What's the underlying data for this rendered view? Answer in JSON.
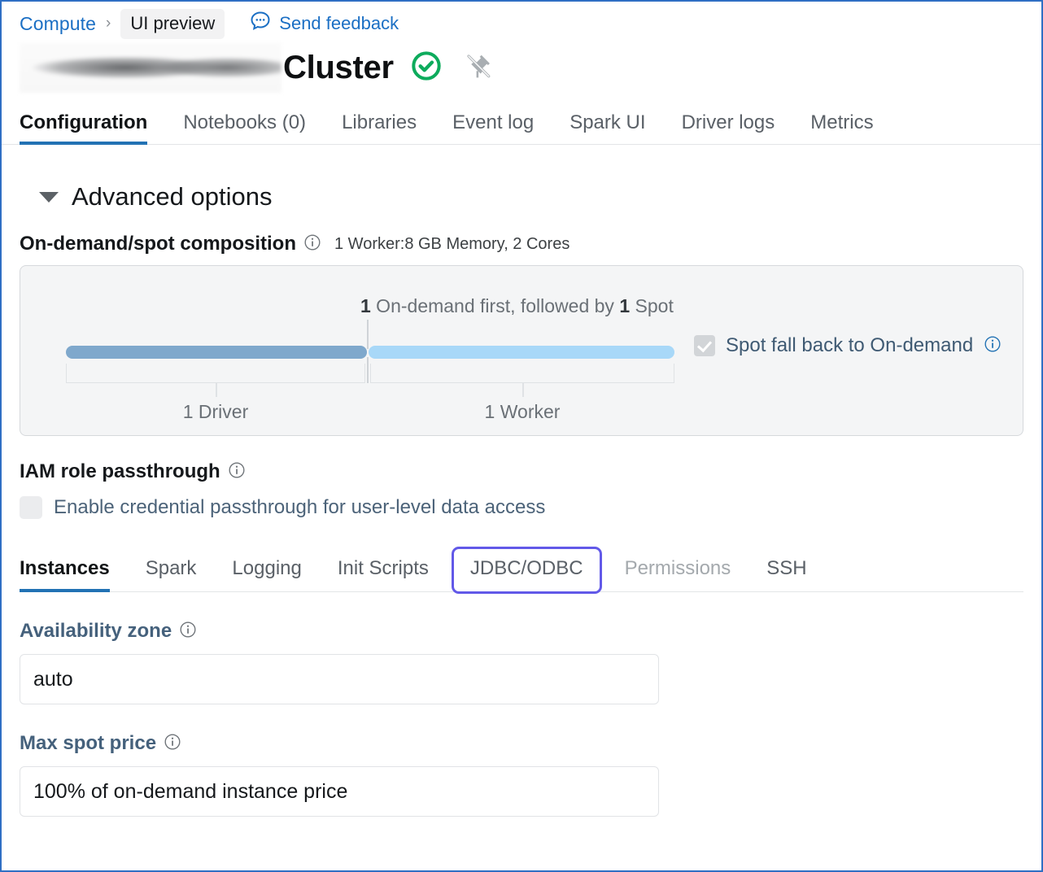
{
  "breadcrumb": {
    "parent": "Compute",
    "separator": "›",
    "preview_badge": "UI preview",
    "feedback_label": "Send feedback"
  },
  "header": {
    "cluster_name_redacted": "",
    "title_suffix": "Cluster",
    "status_icon": "check-circle-icon",
    "pin_icon": "unpin-icon"
  },
  "top_tabs": [
    {
      "label": "Configuration",
      "active": true
    },
    {
      "label": "Notebooks (0)",
      "active": false
    },
    {
      "label": "Libraries",
      "active": false
    },
    {
      "label": "Event log",
      "active": false
    },
    {
      "label": "Spark UI",
      "active": false
    },
    {
      "label": "Driver logs",
      "active": false
    },
    {
      "label": "Metrics",
      "active": false
    }
  ],
  "advanced": {
    "title": "Advanced options",
    "expanded": true
  },
  "composition": {
    "label": "On-demand/spot composition",
    "summary": "1 Worker:8 GB Memory, 2 Cores",
    "caption_prefix": "1",
    "caption_middle": " On-demand first, followed by ",
    "caption_count": "1",
    "caption_suffix": " Spot",
    "driver_label": "1 Driver",
    "worker_label": "1 Worker",
    "fallback_label": "Spot fall back to On-demand",
    "fallback_checked": true,
    "driver_color": "#7fa8cc",
    "worker_color": "#a8d8f8"
  },
  "iam": {
    "title": "IAM role passthrough",
    "checkbox_label": "Enable credential passthrough for user-level data access",
    "checked": false
  },
  "sub_tabs": [
    {
      "label": "Instances",
      "state": "active"
    },
    {
      "label": "Spark",
      "state": "normal"
    },
    {
      "label": "Logging",
      "state": "normal"
    },
    {
      "label": "Init Scripts",
      "state": "normal"
    },
    {
      "label": "JDBC/ODBC",
      "state": "focused"
    },
    {
      "label": "Permissions",
      "state": "muted"
    },
    {
      "label": "SSH",
      "state": "normal"
    }
  ],
  "form": {
    "availability_zone": {
      "label": "Availability zone",
      "value": "auto"
    },
    "max_spot_price": {
      "label": "Max spot price",
      "value": "100% of on-demand instance price"
    }
  },
  "colors": {
    "link": "#1b6fc4",
    "accent": "#2272b4",
    "focus_ring": "#6259e8",
    "status_green": "#0dab5c",
    "page_border": "#2f6fc4"
  }
}
